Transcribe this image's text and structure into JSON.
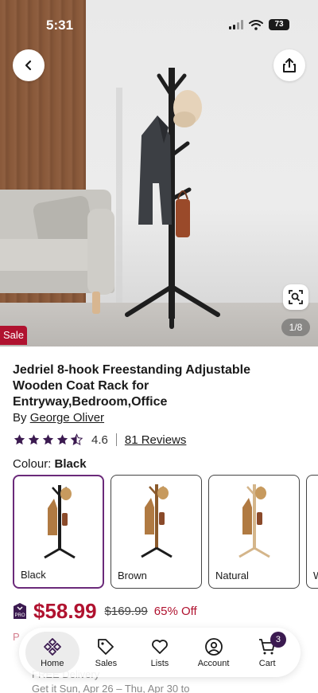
{
  "status_bar": {
    "time": "5:31",
    "battery": "73"
  },
  "gallery": {
    "counter": "1/8",
    "sale_badge": "Sale"
  },
  "product": {
    "title": "Jedriel 8-hook Freestanding Adjustable Wooden Coat Rack for Entryway,Bedroom,Office",
    "by_prefix": "By",
    "brand": "George Oliver",
    "rating": "4.6",
    "reviews_link": "81 Reviews",
    "colour_label": "Colour:",
    "selected_colour": "Black"
  },
  "swatches": [
    {
      "label": "Black",
      "color": "#1c1c1c"
    },
    {
      "label": "Brown",
      "color": "#8b5a2b"
    },
    {
      "label": "Natural",
      "color": "#d4b58a"
    },
    {
      "label": "W",
      "color": "#eeeeee"
    }
  ],
  "pricing": {
    "price": "$58.99",
    "old_price": "$169.99",
    "discount": "65% Off"
  },
  "peek": {
    "promo": "P",
    "delivery_line1": "FREE Delivery",
    "delivery_line2": "Get it Sun, Apr 26 – Thu, Apr 30 to"
  },
  "nav": {
    "items": [
      {
        "label": "Home"
      },
      {
        "label": "Sales"
      },
      {
        "label": "Lists"
      },
      {
        "label": "Account"
      },
      {
        "label": "Cart"
      }
    ],
    "cart_count": "3"
  },
  "colors": {
    "accent": "#b0122f",
    "brand_purple": "#6b2a7a",
    "badge": "#3b1a50"
  }
}
